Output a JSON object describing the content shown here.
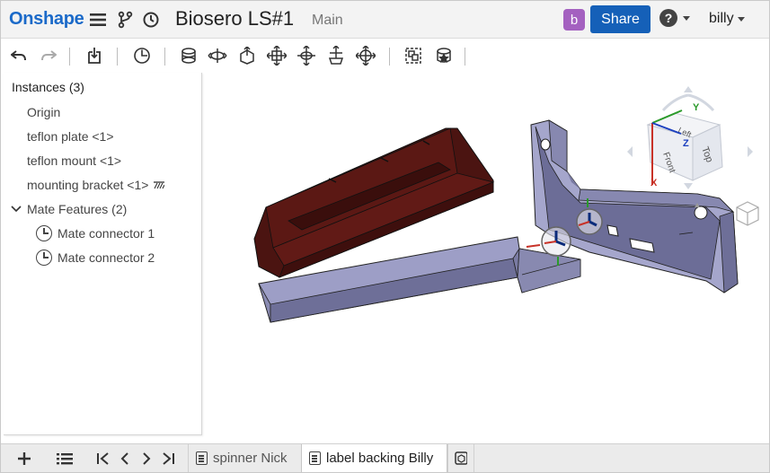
{
  "app": {
    "logo": "Onshape",
    "document_title": "Biosero LS#1",
    "branch": "Main",
    "avatar_letter": "b",
    "share_label": "Share",
    "help_label": "?",
    "user_name": "billy"
  },
  "toolbar": {
    "icons": [
      "undo-icon",
      "redo-icon",
      "insert-icon",
      "mate-connector-icon",
      "fastened-mate-icon",
      "revolute-mate-icon",
      "slider-mate-icon",
      "planar-mate-icon",
      "cylindrical-mate-icon",
      "pin-slot-mate-icon",
      "ball-mate-icon",
      "group-icon",
      "replicate-icon"
    ]
  },
  "instances": {
    "title": "Instances (3)",
    "items": [
      "Origin",
      "teflon plate <1>",
      "teflon mount <1>",
      "mounting bracket <1>"
    ],
    "mate_features_label": "Mate Features (2)",
    "mate_features": [
      "Mate connector 1",
      "Mate connector 2"
    ]
  },
  "view_cube": {
    "faces": [
      "Top",
      "Front",
      "Left"
    ],
    "axes": [
      "X",
      "Y",
      "Z"
    ]
  },
  "tabs": {
    "items": [
      {
        "label": "spinner Nick",
        "active": false
      },
      {
        "label": "label backing Billy",
        "active": true
      }
    ]
  },
  "colors": {
    "brand": "#1b6ac9",
    "share": "#1560b8",
    "avatar": "#a461c0",
    "part_blue": "#8f90b8",
    "part_red": "#4a1210"
  }
}
